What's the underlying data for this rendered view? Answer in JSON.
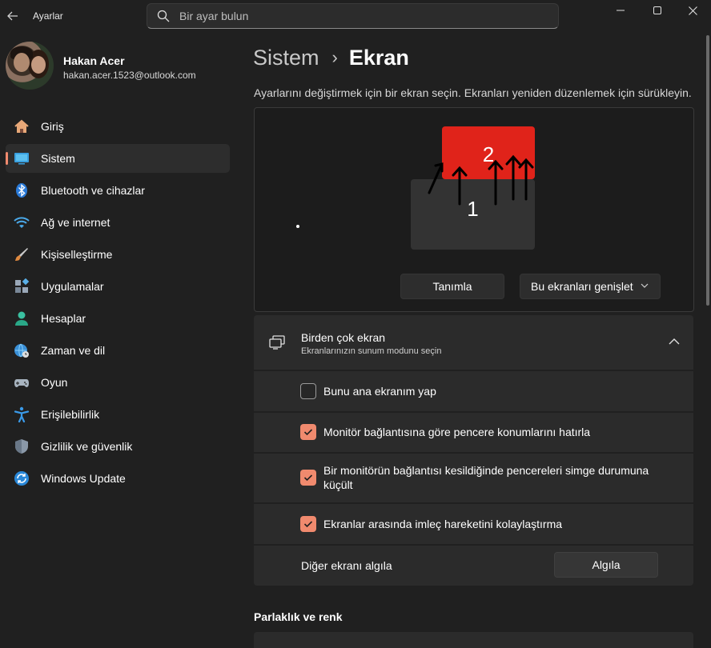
{
  "window": {
    "title": "Ayarlar"
  },
  "search": {
    "placeholder": "Bir ayar bulun"
  },
  "profile": {
    "name": "Hakan Acer",
    "email": "hakan.acer.1523@outlook.com"
  },
  "sidebar": {
    "items": [
      {
        "label": "Giriş",
        "icon": "home-icon",
        "selected": false
      },
      {
        "label": "Sistem",
        "icon": "system-display-icon",
        "selected": true
      },
      {
        "label": "Bluetooth ve cihazlar",
        "icon": "bluetooth-icon",
        "selected": false
      },
      {
        "label": "Ağ ve internet",
        "icon": "wifi-icon",
        "selected": false
      },
      {
        "label": "Kişiselleştirme",
        "icon": "brush-icon",
        "selected": false
      },
      {
        "label": "Uygulamalar",
        "icon": "apps-icon",
        "selected": false
      },
      {
        "label": "Hesaplar",
        "icon": "person-icon",
        "selected": false
      },
      {
        "label": "Zaman ve dil",
        "icon": "globe-clock-icon",
        "selected": false
      },
      {
        "label": "Oyun",
        "icon": "gamepad-icon",
        "selected": false
      },
      {
        "label": "Erişilebilirlik",
        "icon": "accessibility-icon",
        "selected": false
      },
      {
        "label": "Gizlilik ve güvenlik",
        "icon": "shield-icon",
        "selected": false
      },
      {
        "label": "Windows Update",
        "icon": "update-icon",
        "selected": false
      }
    ]
  },
  "breadcrumb": {
    "parent": "Sistem",
    "separator": "›",
    "current": "Ekran"
  },
  "instruction": "Ayarlarını değiştirmek için bir ekran seçin. Ekranları yeniden düzenlemek için sürükleyin.",
  "displays": {
    "monitor1_label": "1",
    "monitor2_label": "2",
    "identify_button": "Tanımla",
    "mode_select": "Bu ekranları genişlet"
  },
  "multiple_displays": {
    "title": "Birden çok ekran",
    "subtitle": "Ekranlarınızın sunum modunu seçin",
    "options": [
      {
        "label": "Bunu ana ekranım yap",
        "checked": false
      },
      {
        "label": "Monitör bağlantısına göre pencere konumlarını hatırla",
        "checked": true
      },
      {
        "label": "Bir monitörün bağlantısı kesildiğinde pencereleri simge durumuna küçült",
        "checked": true
      },
      {
        "label": "Ekranlar arasında imleç hareketini kolaylaştırma",
        "checked": true
      }
    ],
    "detect_label": "Diğer ekranı algıla",
    "detect_button": "Algıla"
  },
  "brightness_section": {
    "title": "Parlaklık ve renk"
  },
  "colors": {
    "accent": "#f08a6e",
    "monitor2": "#e0231a",
    "background": "#202020",
    "card": "#2b2b2b"
  }
}
